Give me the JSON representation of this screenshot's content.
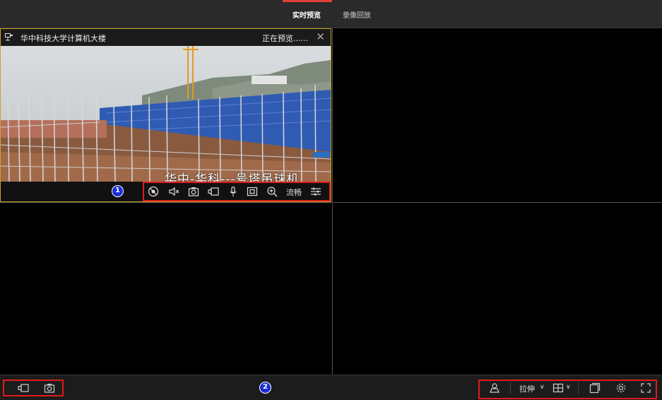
{
  "tabs": [
    {
      "label": "实时预览",
      "active": true
    },
    {
      "label": "录像回放",
      "active": false
    }
  ],
  "panes": [
    {
      "title": "华中科技大学计算机大楼",
      "status": "正在预览......",
      "osd_text": "华中-华科---号塔吊球机",
      "annotation": "1",
      "toolbar": [
        {
          "icon": "ptz-icon"
        },
        {
          "icon": "mute-icon"
        },
        {
          "icon": "snapshot-icon"
        },
        {
          "icon": "record-icon"
        },
        {
          "icon": "microphone-icon"
        },
        {
          "icon": "fullscreen-frame-icon"
        },
        {
          "icon": "zoom-in-icon"
        },
        {
          "label": "流畅"
        },
        {
          "icon": "settings-sliders-icon"
        }
      ]
    },
    {
      "title": ""
    },
    {
      "title": ""
    },
    {
      "title": ""
    }
  ],
  "bottombar": {
    "annotation": "2",
    "left_icons": [
      "record-icon",
      "snapshot-icon"
    ],
    "scale_label": "拉伸",
    "right_icons": [
      "user-icon",
      "layout-grid-icon",
      "window-icon",
      "gear-icon",
      "expand-icon"
    ]
  },
  "colors": {
    "highlight": "#c9a227",
    "annotation_box": "#e01b1b",
    "badge": "#1a2fd6",
    "active_tab": "#e0403a"
  }
}
